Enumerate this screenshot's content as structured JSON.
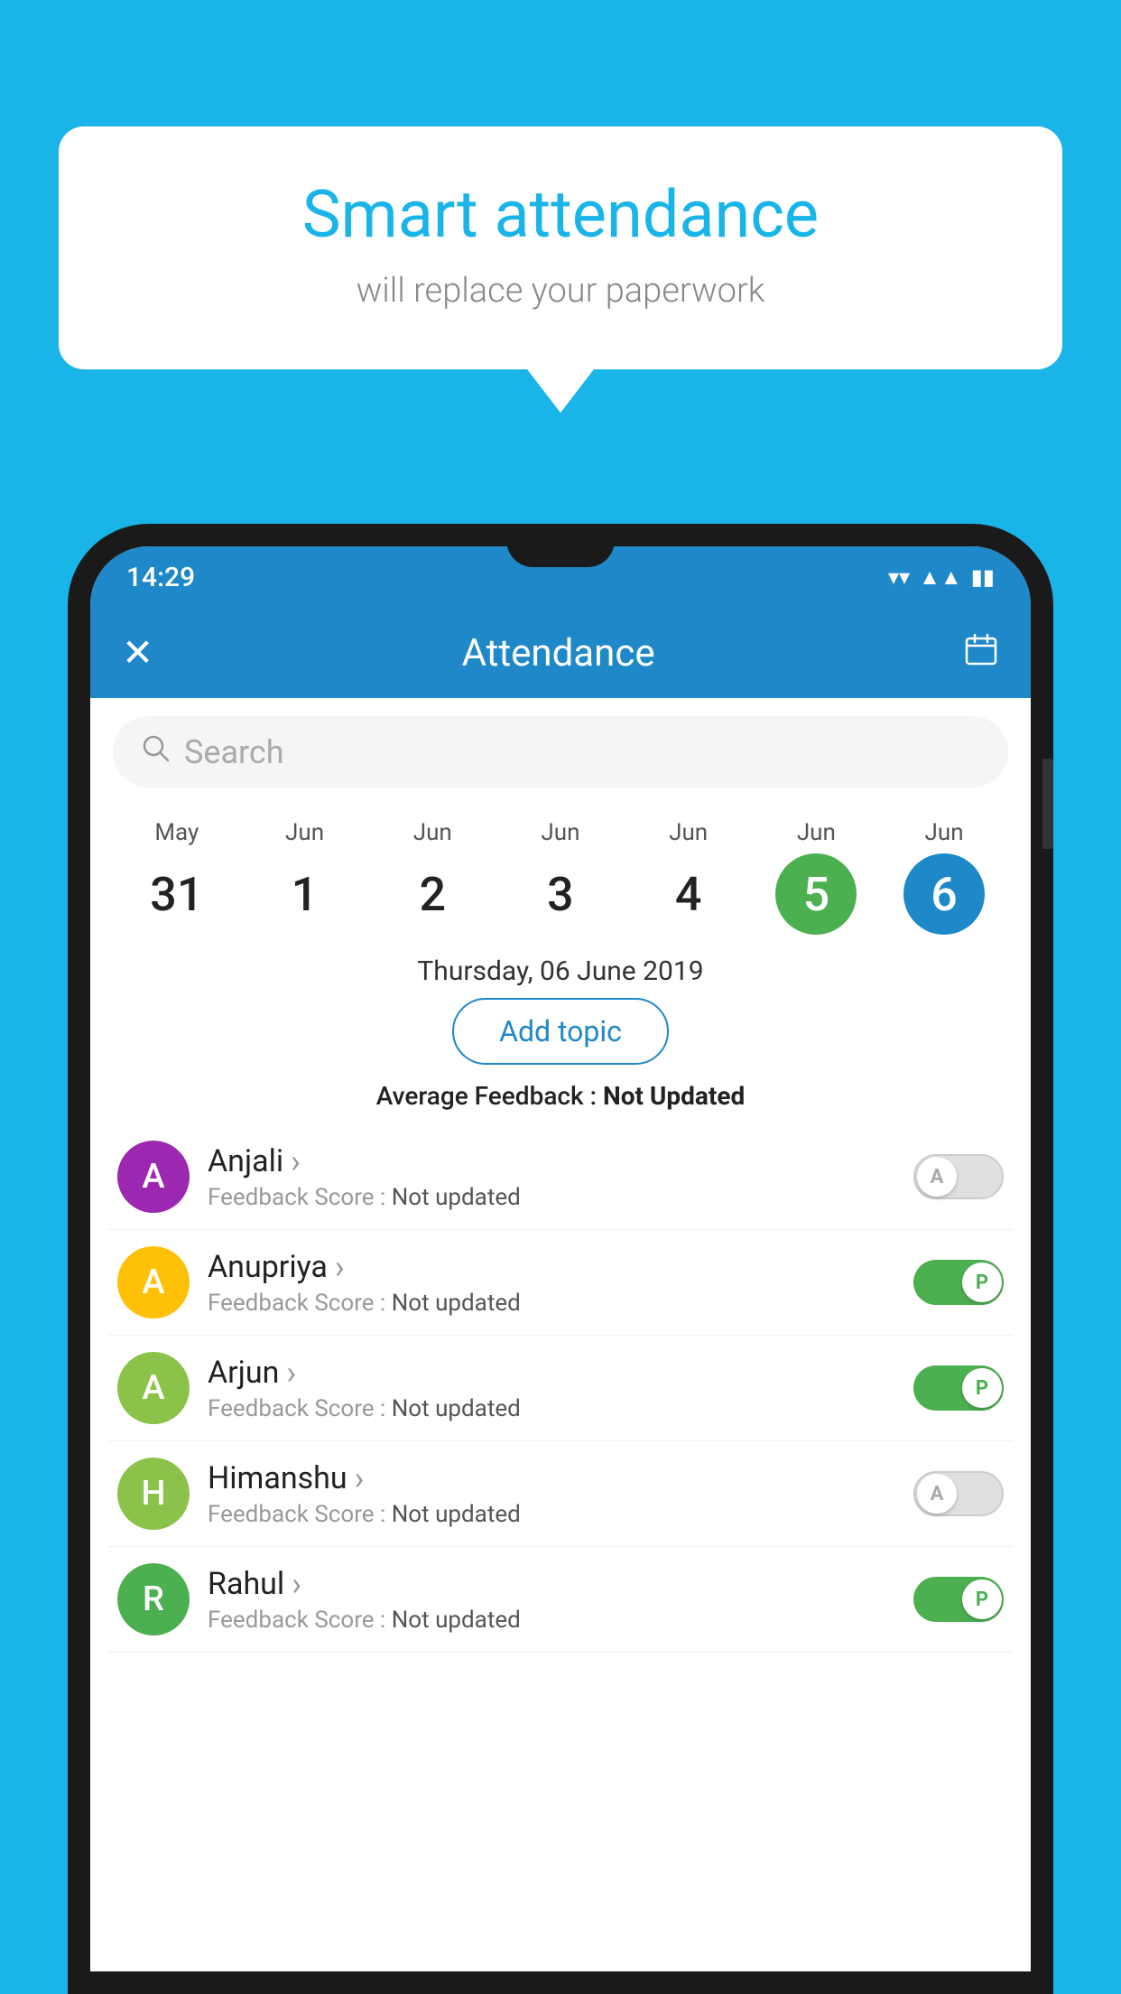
{
  "background_color": "#1ab5e8",
  "bubble": {
    "title": "Smart attendance",
    "subtitle": "will replace your paperwork"
  },
  "status_bar": {
    "time": "14:29",
    "icons": [
      "wifi",
      "signal",
      "battery"
    ]
  },
  "header": {
    "title": "Attendance",
    "close_label": "✕",
    "calendar_icon": "📅"
  },
  "search": {
    "placeholder": "Search"
  },
  "calendar": {
    "days": [
      {
        "month": "May",
        "date": "31",
        "state": "normal"
      },
      {
        "month": "Jun",
        "date": "1",
        "state": "normal"
      },
      {
        "month": "Jun",
        "date": "2",
        "state": "normal"
      },
      {
        "month": "Jun",
        "date": "3",
        "state": "normal"
      },
      {
        "month": "Jun",
        "date": "4",
        "state": "normal"
      },
      {
        "month": "Jun",
        "date": "5",
        "state": "today"
      },
      {
        "month": "Jun",
        "date": "6",
        "state": "selected"
      }
    ],
    "selected_date_label": "Thursday, 06 June 2019"
  },
  "add_topic_label": "Add topic",
  "average_feedback": {
    "label": "Average Feedback :",
    "value": "Not Updated"
  },
  "students": [
    {
      "name": "Anjali",
      "avatar_letter": "A",
      "avatar_color": "#9c27b0",
      "feedback_label": "Feedback Score :",
      "feedback_value": "Not updated",
      "toggle_state": "off",
      "toggle_letter": "A"
    },
    {
      "name": "Anupriya",
      "avatar_letter": "A",
      "avatar_color": "#ffc107",
      "feedback_label": "Feedback Score :",
      "feedback_value": "Not updated",
      "toggle_state": "on",
      "toggle_letter": "P"
    },
    {
      "name": "Arjun",
      "avatar_letter": "A",
      "avatar_color": "#8bc34a",
      "feedback_label": "Feedback Score :",
      "feedback_value": "Not updated",
      "toggle_state": "on",
      "toggle_letter": "P"
    },
    {
      "name": "Himanshu",
      "avatar_letter": "H",
      "avatar_color": "#8bc34a",
      "feedback_label": "Feedback Score :",
      "feedback_value": "Not updated",
      "toggle_state": "off",
      "toggle_letter": "A"
    },
    {
      "name": "Rahul",
      "avatar_letter": "R",
      "avatar_color": "#4caf50",
      "feedback_label": "Feedback Score :",
      "feedback_value": "Not updated",
      "toggle_state": "on",
      "toggle_letter": "P"
    }
  ]
}
